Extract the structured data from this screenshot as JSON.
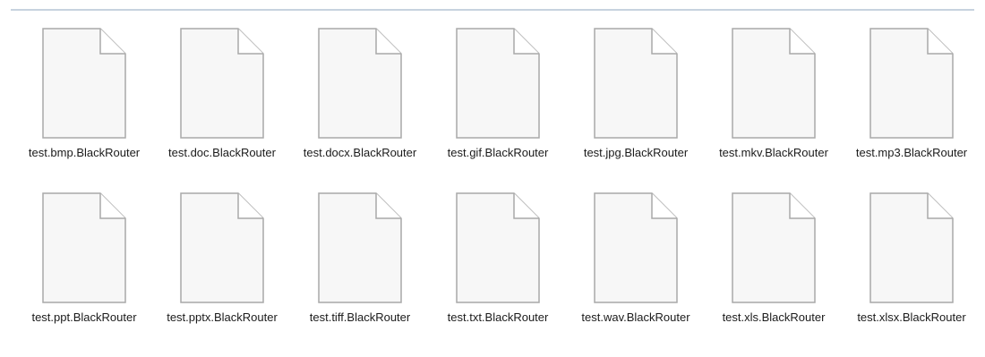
{
  "files": [
    {
      "name": "test.bmp.BlackRouter",
      "icon": "file-icon"
    },
    {
      "name": "test.doc.BlackRouter",
      "icon": "file-icon"
    },
    {
      "name": "test.docx.BlackRouter",
      "icon": "file-icon"
    },
    {
      "name": "test.gif.BlackRouter",
      "icon": "file-icon"
    },
    {
      "name": "test.jpg.BlackRouter",
      "icon": "file-icon"
    },
    {
      "name": "test.mkv.BlackRouter",
      "icon": "file-icon"
    },
    {
      "name": "test.mp3.BlackRouter",
      "icon": "file-icon"
    },
    {
      "name": "test.ppt.BlackRouter",
      "icon": "file-icon"
    },
    {
      "name": "test.pptx.BlackRouter",
      "icon": "file-icon"
    },
    {
      "name": "test.tiff.BlackRouter",
      "icon": "file-icon"
    },
    {
      "name": "test.txt.BlackRouter",
      "icon": "file-icon"
    },
    {
      "name": "test.wav.BlackRouter",
      "icon": "file-icon"
    },
    {
      "name": "test.xls.BlackRouter",
      "icon": "file-icon"
    },
    {
      "name": "test.xlsx.BlackRouter",
      "icon": "file-icon"
    }
  ],
  "colors": {
    "icon_fill": "#f7f7f7",
    "icon_stroke": "#a9a9a9",
    "fold_fill": "#ffffff",
    "text": "#1b1b1b",
    "divider": "#c7d3df"
  }
}
